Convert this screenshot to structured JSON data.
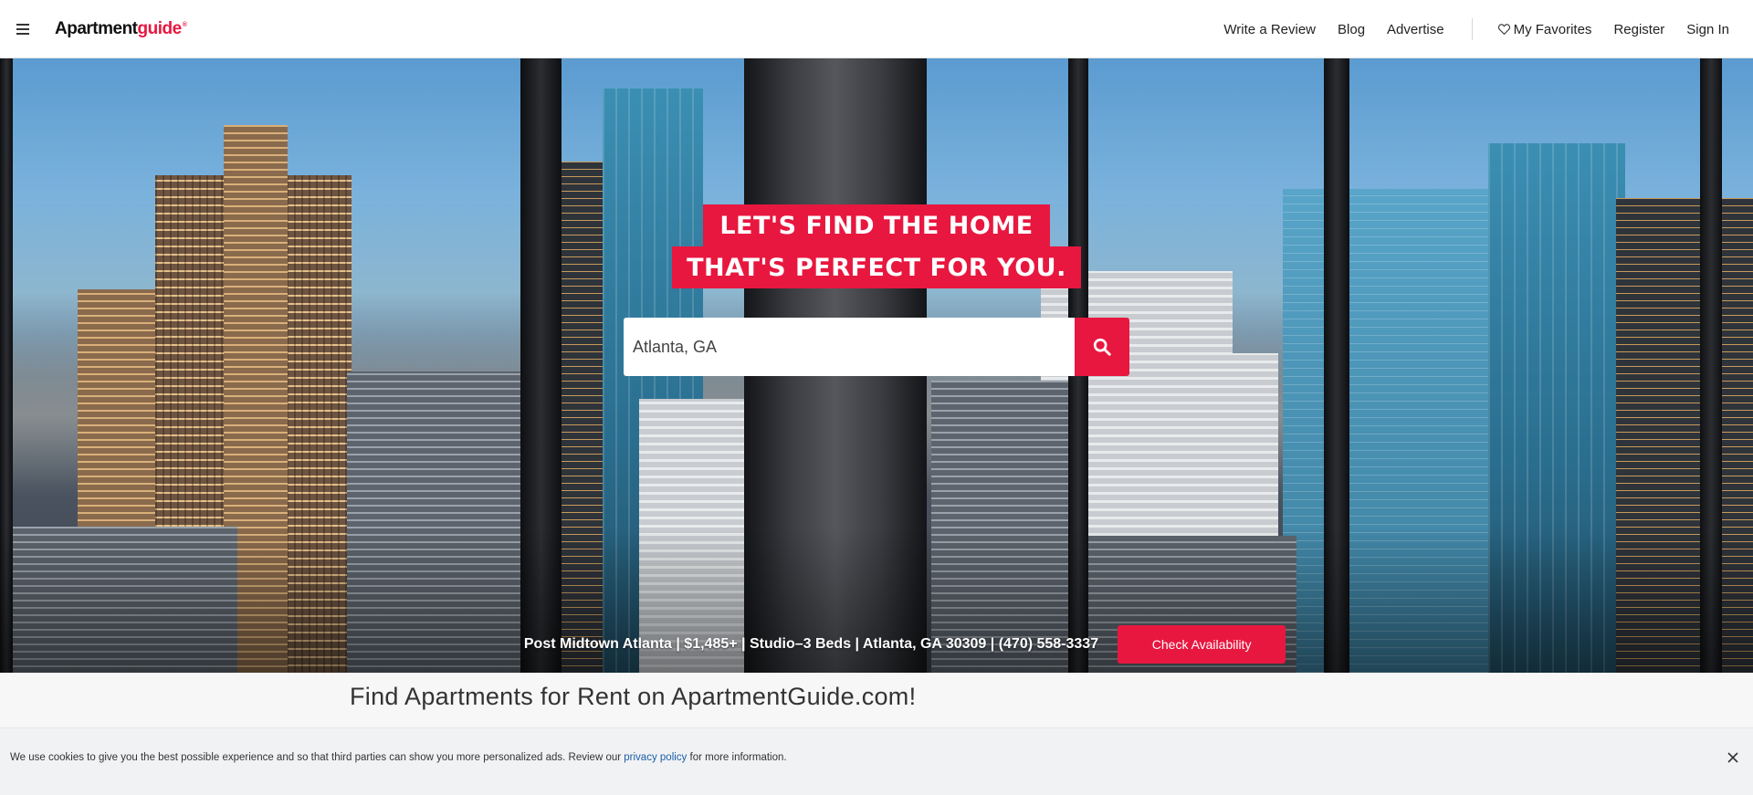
{
  "header": {
    "logo": {
      "part1": "Apartment",
      "part2": "guide",
      "mark": "®"
    },
    "nav": {
      "write_review": "Write a Review",
      "blog": "Blog",
      "advertise": "Advertise",
      "favorites": "My Favorites",
      "register": "Register",
      "sign_in": "Sign In"
    }
  },
  "hero": {
    "headline_line1": "LET'S FIND THE HOME",
    "headline_line2": "THAT'S PERFECT FOR YOU.",
    "search": {
      "value": "Atlanta, GA",
      "placeholder": "Atlanta, GA"
    },
    "promo": {
      "text": "Post Midtown Atlanta | $1,485+ | Studio–3 Beds | Atlanta, GA 30309 | (470) 558-3337",
      "button": "Check Availability"
    }
  },
  "section": {
    "title": "Find Apartments for Rent on ApartmentGuide.com!"
  },
  "cookie": {
    "text_before": "We use cookies to give you the best possible experience and so that third parties can show you more personalized ads. Review our ",
    "link": "privacy policy",
    "text_after": " for more information."
  },
  "colors": {
    "brand_red": "#e8173f",
    "link_blue": "#1a5fa6"
  },
  "icons": [
    "hamburger-menu-icon",
    "heart-icon",
    "search-icon",
    "close-icon"
  ]
}
